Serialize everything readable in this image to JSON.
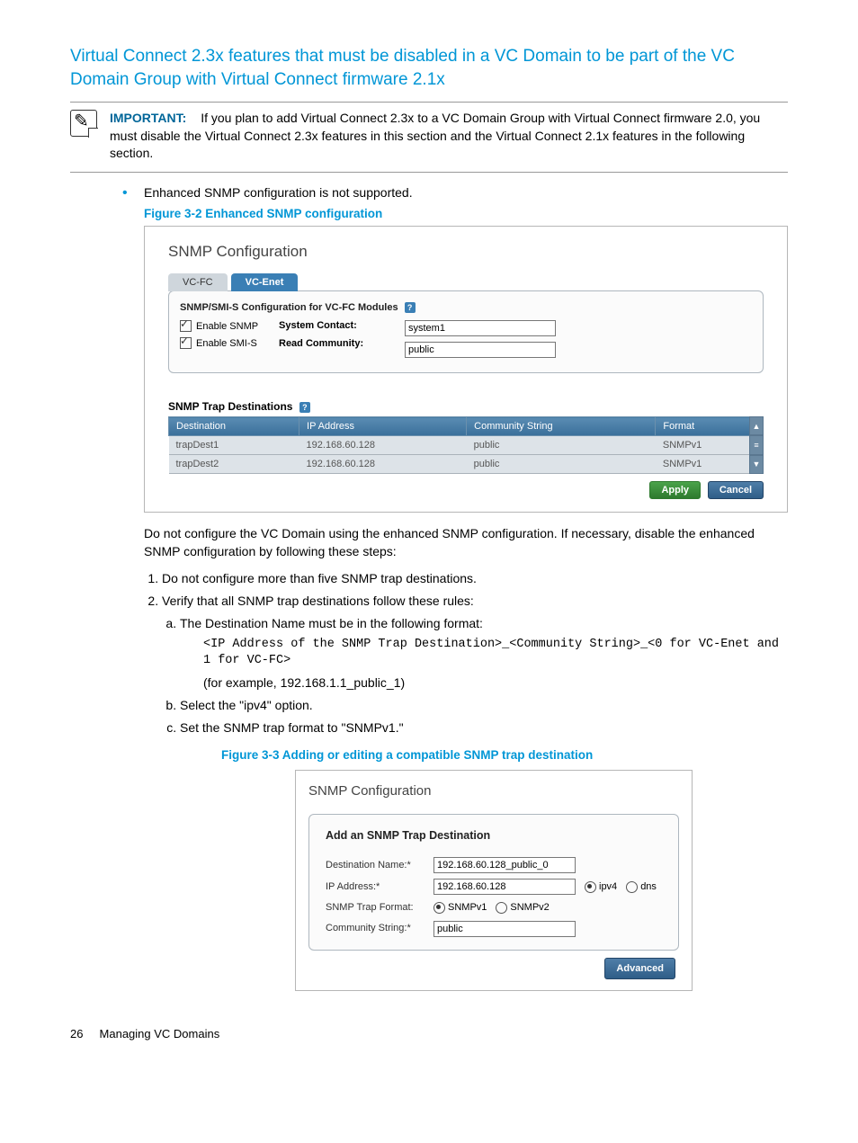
{
  "heading": "Virtual Connect 2.3x features that must be disabled in a VC Domain to be part of the VC Domain Group with Virtual Connect firmware 2.1x",
  "important": {
    "label": "IMPORTANT:",
    "text": "If you plan to add Virtual Connect 2.3x to a VC Domain Group with Virtual Connect firmware 2.0, you must disable the Virtual Connect 2.3x features in this section and the Virtual Connect 2.1x features in the following section."
  },
  "bullet1": "Enhanced SNMP configuration is not supported.",
  "fig32": {
    "caption": "Figure 3-2 Enhanced SNMP configuration",
    "title": "SNMP Configuration",
    "tab_inactive": "VC-FC",
    "tab_active": "VC-Enet",
    "panel_title": "SNMP/SMI-S Configuration for VC-FC Modules",
    "cb1": "Enable SNMP",
    "cb2": "Enable SMI-S",
    "lbl_contact": "System Contact:",
    "val_contact": "system1",
    "lbl_comm": "Read Community:",
    "val_comm": "public",
    "trap_title": "SNMP Trap Destinations",
    "cols": {
      "c1": "Destination",
      "c2": "IP Address",
      "c3": "Community String",
      "c4": "Format"
    },
    "rows": [
      {
        "d": "trapDest1",
        "ip": "192.168.60.128",
        "cs": "public",
        "f": "SNMPv1"
      },
      {
        "d": "trapDest2",
        "ip": "192.168.60.128",
        "cs": "public",
        "f": "SNMPv1"
      }
    ],
    "apply": "Apply",
    "cancel": "Cancel"
  },
  "para_after_fig32": "Do not configure the VC Domain using the enhanced SNMP configuration. If necessary, disable the enhanced SNMP configuration by following these steps:",
  "steps": {
    "s1": "Do not configure more than five SNMP trap destinations.",
    "s2": "Verify that all SNMP trap destinations follow these rules:",
    "s2a": "The Destination Name must be in the following format:",
    "s2a_code": "<IP Address of the SNMP Trap Destination>_<Community String>_<0 for VC-Enet and 1 for VC-FC>",
    "s2a_eg": "(for example, 192.168.1.1_public_1)",
    "s2b": "Select the \"ipv4\" option.",
    "s2c": "Set the SNMP trap format to \"SNMPv1.\""
  },
  "fig33": {
    "caption": "Figure 3-3 Adding or editing a compatible SNMP trap destination",
    "title": "SNMP Configuration",
    "panel_title": "Add an SNMP Trap Destination",
    "lbl_dest": "Destination Name:*",
    "val_dest": "192.168.60.128_public_0",
    "lbl_ip": "IP Address:*",
    "val_ip": "192.168.60.128",
    "r_ipv4": "ipv4",
    "r_dns": "dns",
    "lbl_fmt": "SNMP Trap Format:",
    "r_v1": "SNMPv1",
    "r_v2": "SNMPv2",
    "lbl_cs": "Community String:*",
    "val_cs": "public",
    "advanced": "Advanced"
  },
  "footer": {
    "page": "26",
    "section": "Managing VC Domains"
  }
}
